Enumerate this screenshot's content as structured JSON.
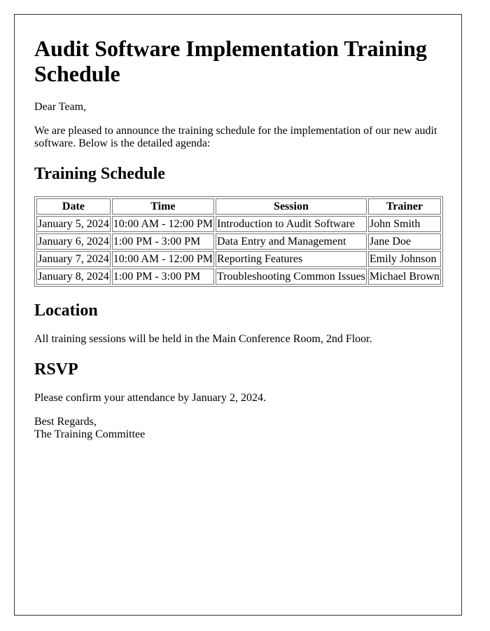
{
  "title": "Audit Software Implementation Training Schedule",
  "greeting": "Dear Team,",
  "intro": "We are pleased to announce the training schedule for the implementation of our new audit software. Below is the detailed agenda:",
  "schedule": {
    "heading": "Training Schedule",
    "columns": [
      "Date",
      "Time",
      "Session",
      "Trainer"
    ],
    "rows": [
      [
        "January 5, 2024",
        "10:00 AM - 12:00 PM",
        "Introduction to Audit Software",
        "John Smith"
      ],
      [
        "January 6, 2024",
        "1:00 PM - 3:00 PM",
        "Data Entry and Management",
        "Jane Doe"
      ],
      [
        "January 7, 2024",
        "10:00 AM - 12:00 PM",
        "Reporting Features",
        "Emily Johnson"
      ],
      [
        "January 8, 2024",
        "1:00 PM - 3:00 PM",
        "Troubleshooting Common Issues",
        "Michael Brown"
      ]
    ]
  },
  "location": {
    "heading": "Location",
    "text": "All training sessions will be held in the Main Conference Room, 2nd Floor."
  },
  "rsvp": {
    "heading": "RSVP",
    "text": "Please confirm your attendance by January 2, 2024."
  },
  "closing": {
    "salutation": "Best Regards,",
    "signature": "The Training Committee"
  }
}
